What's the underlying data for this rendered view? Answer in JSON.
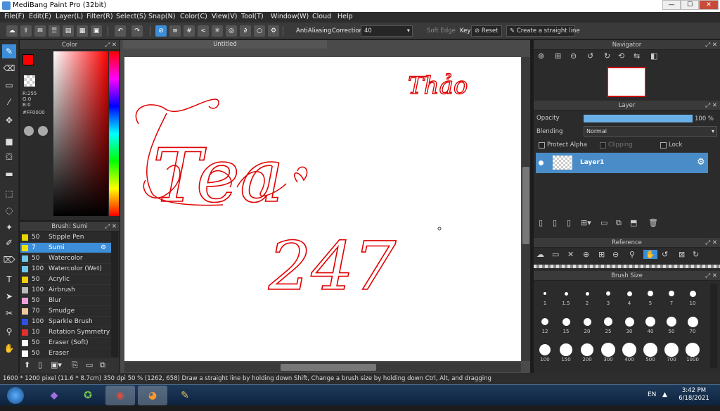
{
  "window": {
    "title": "MediBang Paint Pro (32bit)",
    "min_label": "—",
    "max_label": "☐",
    "close_label": "✕"
  },
  "menu": [
    "File(F)",
    "Edit(E)",
    "Layer(L)",
    "Filter(R)",
    "Select(S)",
    "Snap(N)",
    "Color(C)",
    "View(V)",
    "Tool(T)",
    "Window(W)",
    "Cloud",
    "Help"
  ],
  "toolbar": {
    "antialias_label": "AntiAliasing",
    "correction_label": "Correction",
    "correction_value": "40",
    "soft_edge_label": "Soft Edge",
    "key_label": "Key",
    "reset_label": "Reset",
    "straight_line_label": "Create a straight line"
  },
  "color_panel": {
    "title": "Color",
    "r_label": "R:255",
    "g_label": "G:0",
    "b_label": "B:0",
    "hex": "#FF0000",
    "fg": "#ff0000"
  },
  "brush_panel": {
    "title": "Brush: Sumi",
    "items": [
      {
        "size": "50",
        "name": "Stipple Pen",
        "swatch": "#e8d400"
      },
      {
        "size": "7",
        "name": "Sumi",
        "swatch": "#f0e000",
        "selected": true
      },
      {
        "size": "50",
        "name": "Watercolor",
        "swatch": "#6ec6e8"
      },
      {
        "size": "100",
        "name": "Watercolor (Wet)",
        "swatch": "#6ec6e8"
      },
      {
        "size": "50",
        "name": "Acrylic",
        "swatch": "#f0d000"
      },
      {
        "size": "100",
        "name": "Airbrush",
        "swatch": "#bbbbbb"
      },
      {
        "size": "50",
        "name": "Blur",
        "swatch": "#f0a0d8"
      },
      {
        "size": "70",
        "name": "Smudge",
        "swatch": "#f0c8a0"
      },
      {
        "size": "100",
        "name": "Sparkle Brush",
        "swatch": "#3050e0"
      },
      {
        "size": "10",
        "name": "Rotation Symmetry P",
        "swatch": "#e03030"
      },
      {
        "size": "50",
        "name": "Eraser (Soft)",
        "swatch": "#ffffff"
      },
      {
        "size": "50",
        "name": "Eraser",
        "swatch": "#ffffff"
      }
    ]
  },
  "canvas": {
    "tab": "Untitled",
    "texts": {
      "thao": "Thảo",
      "tea": "Tea",
      "num": "247"
    }
  },
  "navigator": {
    "title": "Navigator"
  },
  "layer_panel": {
    "title": "Layer",
    "opacity_label": "Opacity",
    "opacity_value": "100 %",
    "opacity_fraction": 1.0,
    "blending_label": "Blending",
    "blending_value": "Normal",
    "protect_alpha": "Protect Alpha",
    "clipping": "Clipping",
    "lock": "Lock",
    "layer_name": "Layer1"
  },
  "reference": {
    "title": "Reference"
  },
  "brush_size": {
    "title": "Brush Size",
    "sizes": [
      "1",
      "1.5",
      "2",
      "3",
      "4",
      "5",
      "7",
      "10",
      "12",
      "15",
      "20",
      "25",
      "30",
      "40",
      "50",
      "70",
      "100",
      "150",
      "200",
      "300",
      "400",
      "500",
      "700",
      "1000"
    ]
  },
  "status": {
    "text": "1600 * 1200 pixel   (11.6 * 8.7cm)   350 dpi   50 %   (1262, 658)   Draw a straight line by holding down Shift, Change a brush size by holding down Ctrl, Alt, and dragging"
  },
  "taskbar": {
    "lang": "EN",
    "time": "3:42 PM",
    "date": "6/18/2021"
  }
}
